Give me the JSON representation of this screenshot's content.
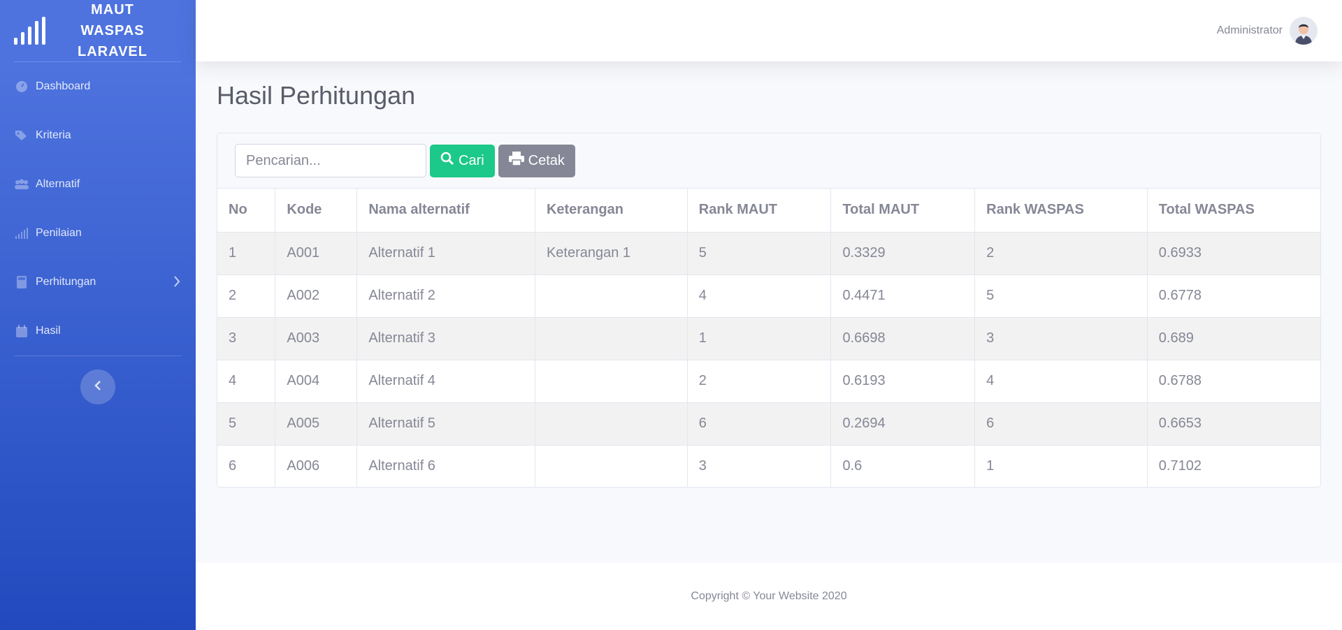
{
  "brand": {
    "title": "MAUT\nWASPAS\nLARAVEL"
  },
  "sidebar": {
    "items": [
      {
        "label": "Dashboard",
        "icon": "dashboard-icon"
      },
      {
        "label": "Kriteria",
        "icon": "tags-icon"
      },
      {
        "label": "Alternatif",
        "icon": "users-icon"
      },
      {
        "label": "Penilaian",
        "icon": "signal-icon"
      },
      {
        "label": "Perhitungan",
        "icon": "calculator-icon",
        "has_submenu": true
      },
      {
        "label": "Hasil",
        "icon": "calendar-icon"
      }
    ]
  },
  "topbar": {
    "user_name": "Administrator"
  },
  "page": {
    "title": "Hasil Perhitungan"
  },
  "toolbar": {
    "search_placeholder": "Pencarian...",
    "search_button": "Cari",
    "print_button": "Cetak"
  },
  "table": {
    "headers": [
      "No",
      "Kode",
      "Nama alternatif",
      "Keterangan",
      "Rank MAUT",
      "Total MAUT",
      "Rank WASPAS",
      "Total WASPAS"
    ],
    "rows": [
      [
        "1",
        "A001",
        "Alternatif 1",
        "Keterangan 1",
        "5",
        "0.3329",
        "2",
        "0.6933"
      ],
      [
        "2",
        "A002",
        "Alternatif 2",
        "",
        "4",
        "0.4471",
        "5",
        "0.6778"
      ],
      [
        "3",
        "A003",
        "Alternatif 3",
        "",
        "1",
        "0.6698",
        "3",
        "0.689"
      ],
      [
        "4",
        "A004",
        "Alternatif 4",
        "",
        "2",
        "0.6193",
        "4",
        "0.6788"
      ],
      [
        "5",
        "A005",
        "Alternatif 5",
        "",
        "6",
        "0.2694",
        "6",
        "0.6653"
      ],
      [
        "6",
        "A006",
        "Alternatif 6",
        "",
        "3",
        "0.6",
        "1",
        "0.7102"
      ]
    ]
  },
  "footer": {
    "text": "Copyright © Your Website 2020"
  },
  "colors": {
    "sidebar_top": "#4e73df",
    "sidebar_bottom": "#224abe",
    "success": "#1cc88a",
    "secondary": "#858796"
  }
}
